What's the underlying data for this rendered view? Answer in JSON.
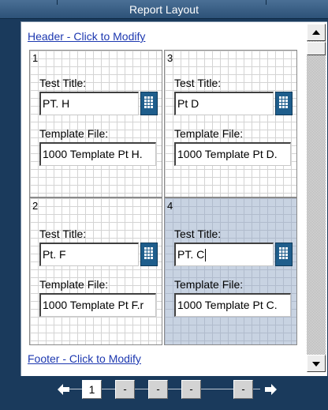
{
  "window": {
    "title": "Report Layout"
  },
  "header_link": "Header - Click to Modify",
  "footer_link": "Footer - Click to Modify",
  "panels": [
    {
      "number": "1",
      "test_title_label": "Test Title:",
      "test_title": "PT. H",
      "template_label": "Template File:",
      "template_file": "1000 Template Pt H."
    },
    {
      "number": "3",
      "test_title_label": "Test Title:",
      "test_title": "Pt D",
      "template_label": "Template File:",
      "template_file": "1000 Template Pt D."
    },
    {
      "number": "2",
      "test_title_label": "Test Title:",
      "test_title": "Pt. F",
      "template_label": "Template File:",
      "template_file": "1000 Template Pt F.r"
    },
    {
      "number": "4",
      "test_title_label": "Test Title:",
      "test_title": "PT. C",
      "template_label": "Template File:",
      "template_file": "1000 Template Pt C."
    }
  ],
  "selected_panel": "4",
  "pager": {
    "pages": [
      "1",
      "-",
      "-",
      "-",
      "-"
    ],
    "current": "1"
  },
  "colors": {
    "background": "#1a3a5c",
    "link": "#1d38b0",
    "selected_panel": "#c8d3e2",
    "picker_button": "#1f5e8c"
  },
  "icons": {
    "picker": "grid-picker-icon",
    "scroll_up": "arrow-up-icon",
    "scroll_down": "arrow-down-icon",
    "prev": "arrow-left-icon",
    "next": "arrow-right-icon"
  }
}
